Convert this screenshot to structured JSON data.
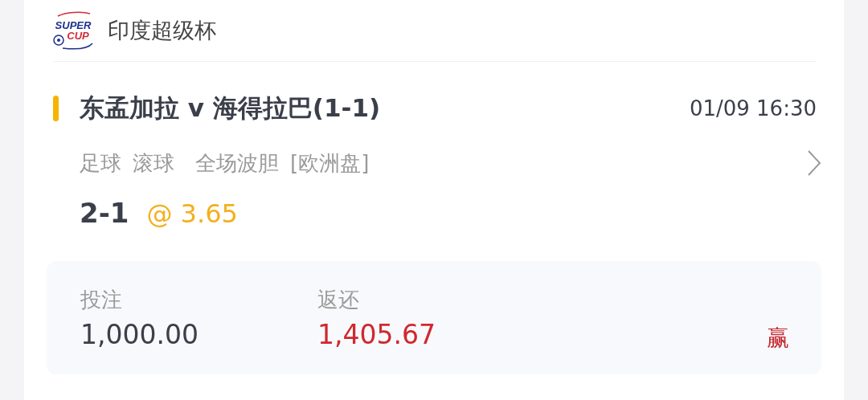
{
  "league": {
    "logo": {
      "line1": "SUPER",
      "line2": "CUP"
    },
    "name": "印度超级杯"
  },
  "match": {
    "title": "东孟加拉 v 海得拉巴(1-1)",
    "time": "01/09 16:30",
    "tags": [
      "足球",
      "滚球",
      "全场波胆",
      "[欧洲盘]"
    ],
    "pick": "2-1",
    "odds": "@ 3.65"
  },
  "summary": {
    "stake_label": "投注",
    "stake": "1,000.00",
    "return_label": "返还",
    "return": "1,405.67",
    "result": "赢"
  }
}
